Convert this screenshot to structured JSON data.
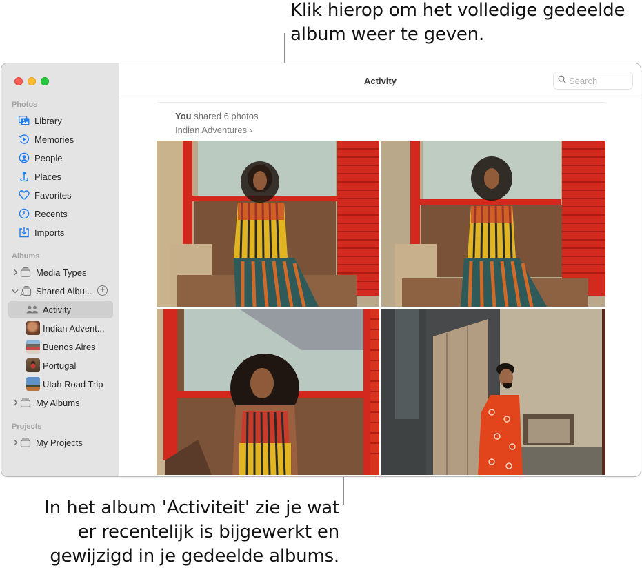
{
  "callouts": {
    "top": "Klik hierop om het volledige gedeelde album weer te geven.",
    "bottom": "In het album 'Activiteit' zie je wat er recentelijk is bijgewerkt en gewijzigd in je gedeelde albums."
  },
  "window": {
    "title": "Activity",
    "search": {
      "placeholder": "Search",
      "value": ""
    }
  },
  "sidebar": {
    "sections": {
      "photos": "Photos",
      "albums": "Albums",
      "projects": "Projects"
    },
    "photos_items": [
      {
        "label": "Library",
        "icon": "library-icon"
      },
      {
        "label": "Memories",
        "icon": "memories-icon"
      },
      {
        "label": "People",
        "icon": "people-icon"
      },
      {
        "label": "Places",
        "icon": "places-icon"
      },
      {
        "label": "Favorites",
        "icon": "heart-icon"
      },
      {
        "label": "Recents",
        "icon": "clock-icon"
      },
      {
        "label": "Imports",
        "icon": "import-icon"
      }
    ],
    "albums_items": [
      {
        "label": "Media Types",
        "expanded": false
      },
      {
        "label": "Shared Albu...",
        "expanded": true
      },
      {
        "label": "Activity",
        "selected": true
      },
      {
        "label": "Indian Advent..."
      },
      {
        "label": "Buenos Aires"
      },
      {
        "label": "Portugal"
      },
      {
        "label": "Utah Road Trip"
      },
      {
        "label": "My Albums",
        "expanded": false
      }
    ],
    "projects_items": [
      {
        "label": "My Projects",
        "expanded": false
      }
    ]
  },
  "activity": {
    "actor": "You",
    "action": " shared 6 photos",
    "album_link": "Indian Adventures",
    "album_chevron": "›",
    "photos": [
      {
        "description": "Woman in striped dress sitting, hand on head, red shutter wall"
      },
      {
        "description": "Woman in striped dress sitting on bench, red shutter wall"
      },
      {
        "description": "Woman with curly hair, eyes closed, against weathered wall"
      },
      {
        "description": "Man in orange shirt next to old door"
      }
    ]
  },
  "colors": {
    "accent": "#1b7cf2",
    "sidebar_bg": "#e4e4e4",
    "selection": "#cfcfcf"
  }
}
